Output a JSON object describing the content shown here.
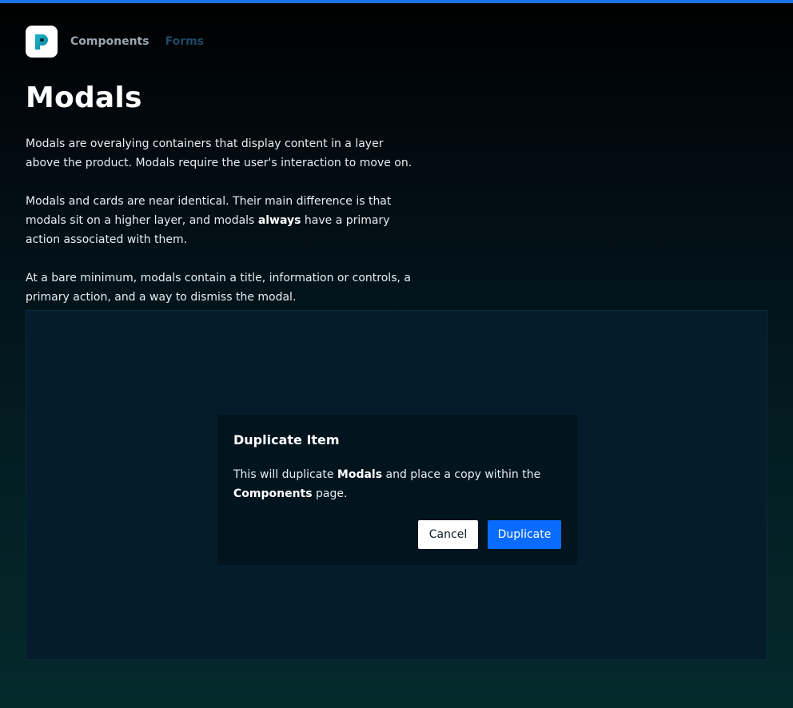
{
  "header": {
    "logo_icon": "p-logo-icon",
    "breadcrumbs": [
      "Components",
      "Forms"
    ]
  },
  "page": {
    "title": "Modals",
    "paragraphs": [
      {
        "before": "Modals are overalying containers that display content in a layer above the product. Modals require the user's interaction to move on."
      },
      {
        "before": "Modals and cards are near identical. Their main difference is that modals sit on a higher layer, and modals ",
        "bold": "always",
        "after": " have a primary action associated with them."
      },
      {
        "before": "At a bare minimum, modals contain a title, information or controls, a primary action, and a way to dismiss the modal."
      }
    ]
  },
  "modal": {
    "title": "Duplicate Item",
    "body": {
      "t1": "This will duplicate ",
      "b1": "Modals",
      "t2": " and place a copy within the ",
      "b2": "Components",
      "t3": " page."
    },
    "cancel_label": "Cancel",
    "primary_label": "Duplicate"
  },
  "colors": {
    "accent": "#0a6cff",
    "top_bar": "#1a73e8",
    "modal_bg": "#02141e",
    "stage_bg": "#041c2b"
  }
}
